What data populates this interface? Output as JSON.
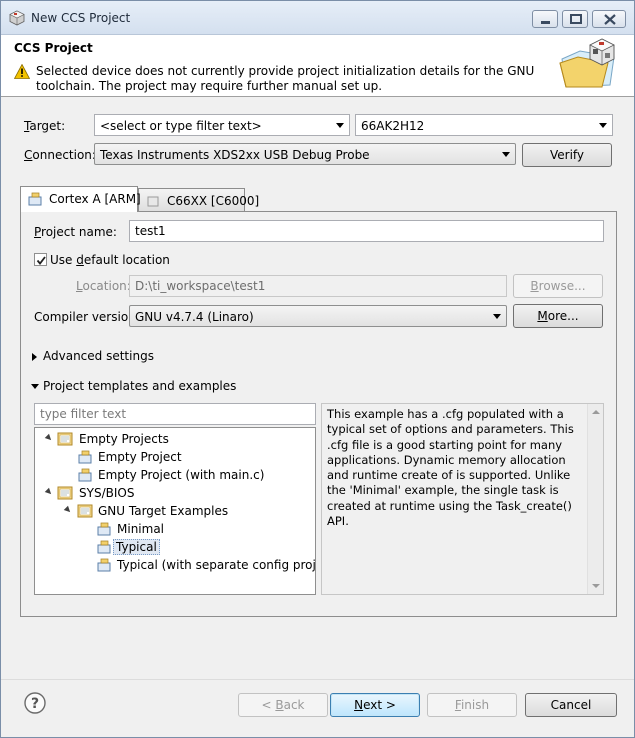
{
  "window": {
    "title": "New CCS Project"
  },
  "header": {
    "title": "CCS Project",
    "message": "Selected device does not currently provide project initialization details for the GNU toolchain. The project may require further manual set up."
  },
  "target": {
    "label_prefix": "",
    "label_underlined": "T",
    "label_rest": "arget:",
    "filter_placeholder": "<select or type filter text>",
    "device": "66AK2H12"
  },
  "connection": {
    "label_underlined": "C",
    "label_rest": "onnection:",
    "value": "Texas Instruments XDS2xx USB Debug Probe",
    "verify_label": "Verify"
  },
  "tabs": [
    {
      "label": "Cortex A [ARM]",
      "active": true
    },
    {
      "label": "C66XX [C6000]",
      "active": false
    }
  ],
  "project": {
    "name_label_underlined": "P",
    "name_label_rest": "roject name:",
    "name_value": "test1",
    "use_default_prefix": "Use ",
    "use_default_underlined": "d",
    "use_default_rest": "efault location",
    "use_default_checked": true,
    "location_label_underlined": "L",
    "location_label_rest": "ocation:",
    "location_value": "D:\\ti_workspace\\test1",
    "browse_label_underlined": "B",
    "browse_label_rest": "rowse...",
    "compiler_label": "Compiler version:",
    "compiler_value": "GNU v4.7.4 (Linaro)",
    "more_label_underlined": "M",
    "more_label_rest": "ore..."
  },
  "sections": {
    "advanced": "Advanced settings",
    "templates": "Project templates and examples"
  },
  "templates": {
    "filter_placeholder": "type filter text",
    "tree": [
      {
        "label": "Empty Projects",
        "level": 0,
        "expanded": true,
        "folder": true
      },
      {
        "label": "Empty Project",
        "level": 1,
        "folder": false
      },
      {
        "label": "Empty Project (with main.c)",
        "level": 1,
        "folder": false
      },
      {
        "label": "SYS/BIOS",
        "level": 0,
        "expanded": true,
        "folder": true
      },
      {
        "label": "GNU Target Examples",
        "level": 1,
        "expanded": true,
        "folder": true
      },
      {
        "label": "Minimal",
        "level": 2,
        "folder": false
      },
      {
        "label": "Typical",
        "level": 2,
        "folder": false,
        "selected": true
      },
      {
        "label": "Typical (with separate config project)",
        "level": 2,
        "folder": false
      }
    ],
    "description": "This example has a .cfg populated with a typical set of options and parameters.  This .cfg file is a good starting point for many applications. Dynamic memory allocation and runtime create of is supported.  Unlike the 'Minimal' example, the single task is created at runtime using the Task_create() API."
  },
  "footer": {
    "back_prefix": "< ",
    "back_underlined": "B",
    "back_rest": "ack",
    "next_underlined": "N",
    "next_rest": "ext >",
    "finish_underlined": "F",
    "finish_rest": "inish",
    "cancel_label": "Cancel"
  },
  "colors": {
    "warning": "#f2c200",
    "folder": "#e8b94a",
    "selection": "#e0e8f3",
    "default_button_border": "#3c7fb1"
  },
  "icons": {
    "title": "ccs-icon",
    "warning": "warning-icon",
    "wizard": "new-project-wizard-icon",
    "help": "help-icon",
    "folder": "template-folder-icon",
    "project": "project-template-icon"
  }
}
